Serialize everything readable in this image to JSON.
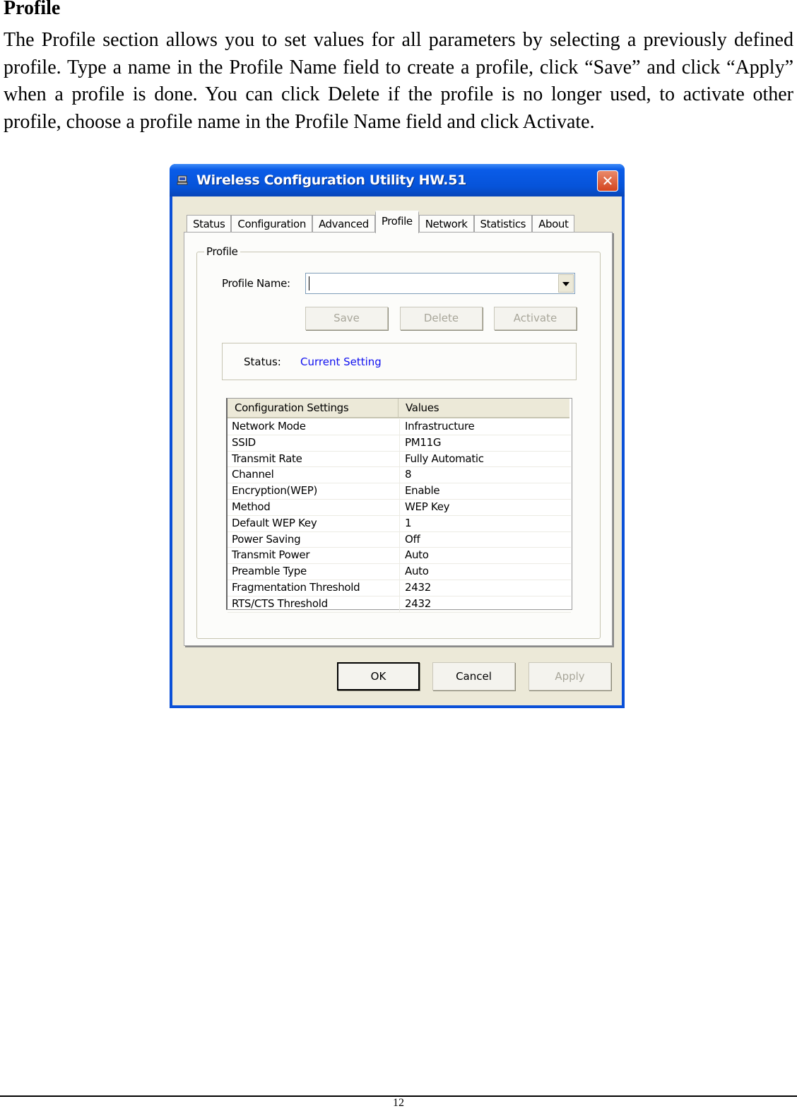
{
  "document": {
    "heading": "Profile",
    "paragraph": "The Profile section allows you to set values for all parameters by selecting a previously defined profile. Type a name in the Profile Name field to create a profile, click “Save” and click “Apply” when a profile is done. You can click Delete if the profile is no longer used, to activate other profile, choose a profile name in the Profile Name field and click Activate.",
    "page_number": "12"
  },
  "window": {
    "title": "Wireless Configuration Utility HW.51",
    "close_glyph": "✕",
    "tabs": [
      {
        "label": "Status",
        "active": false
      },
      {
        "label": "Configuration",
        "active": false
      },
      {
        "label": "Advanced",
        "active": false
      },
      {
        "label": "Profile",
        "active": true
      },
      {
        "label": "Network",
        "active": false
      },
      {
        "label": "Statistics",
        "active": false
      },
      {
        "label": "About",
        "active": false
      }
    ],
    "profile": {
      "group_label": "Profile",
      "profile_name_label": "Profile Name:",
      "profile_name_value": "",
      "buttons": {
        "save": "Save",
        "delete": "Delete",
        "activate": "Activate"
      },
      "status_label": "Status:",
      "status_value": "Current Setting",
      "status_color": "#1010f0",
      "table": {
        "headers": [
          "Configuration Settings",
          "Values"
        ],
        "rows": [
          [
            "Network Mode",
            "Infrastructure"
          ],
          [
            "SSID",
            "PM11G"
          ],
          [
            "Transmit Rate",
            "Fully Automatic"
          ],
          [
            "Channel",
            "8"
          ],
          [
            "Encryption(WEP)",
            "Enable"
          ],
          [
            "Method",
            "WEP Key"
          ],
          [
            "Default WEP Key",
            "1"
          ],
          [
            "Power Saving",
            "Off"
          ],
          [
            "Transmit Power",
            "Auto"
          ],
          [
            "Preamble Type",
            "Auto"
          ],
          [
            "Fragmentation Threshold",
            "2432"
          ],
          [
            "RTS/CTS Threshold",
            "2432"
          ]
        ]
      }
    },
    "footer_buttons": {
      "ok": "OK",
      "cancel": "Cancel",
      "apply": "Apply"
    }
  }
}
